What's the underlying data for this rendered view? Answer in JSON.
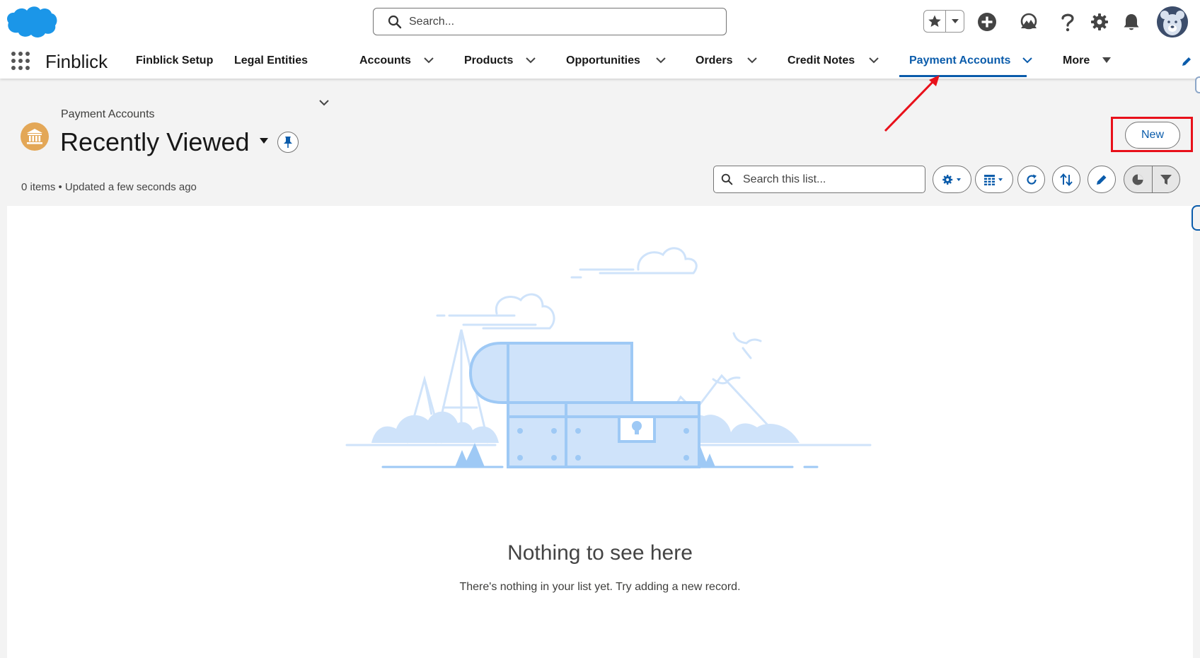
{
  "global_header": {
    "search_placeholder": "Search...",
    "icons": [
      "salesforce-cloud-logo",
      "favorites-star-icon",
      "chevron-down-icon",
      "add-icon",
      "trailhead-icon",
      "help-icon",
      "setup-gear-icon",
      "notifications-bell-icon",
      "user-avatar"
    ]
  },
  "nav": {
    "app_name": "Finblick",
    "items": [
      {
        "label": "Finblick Setup",
        "has_menu": false
      },
      {
        "label": "Legal Entities",
        "has_menu": true
      },
      {
        "label": "Accounts",
        "has_menu": true
      },
      {
        "label": "Products",
        "has_menu": true
      },
      {
        "label": "Opportunities",
        "has_menu": true
      },
      {
        "label": "Orders",
        "has_menu": true
      },
      {
        "label": "Credit Notes",
        "has_menu": true
      },
      {
        "label": "Payment Accounts",
        "has_menu": true,
        "active": true
      },
      {
        "label": "More",
        "has_menu": true
      }
    ]
  },
  "list_view": {
    "object_label": "Payment Accounts",
    "view_name": "Recently Viewed",
    "status": "0 items • Updated a few seconds ago",
    "new_button": "New",
    "search_placeholder": "Search this list...",
    "toolbar_icons": [
      "list-settings-gear-icon",
      "display-as-table-icon",
      "refresh-icon",
      "sort-icon",
      "edit-list-icon",
      "charts-icon",
      "filter-icon"
    ]
  },
  "empty_state": {
    "title": "Nothing to see here",
    "message": "There's nothing in your list yet. Try adding a new record."
  },
  "colors": {
    "brand_blue": "#0b5cab",
    "object_icon_bg": "#e3a757",
    "annotation_red": "#e8101a",
    "illustration_fill": "#cfe3fa",
    "illustration_stroke": "#9ec9f5"
  }
}
